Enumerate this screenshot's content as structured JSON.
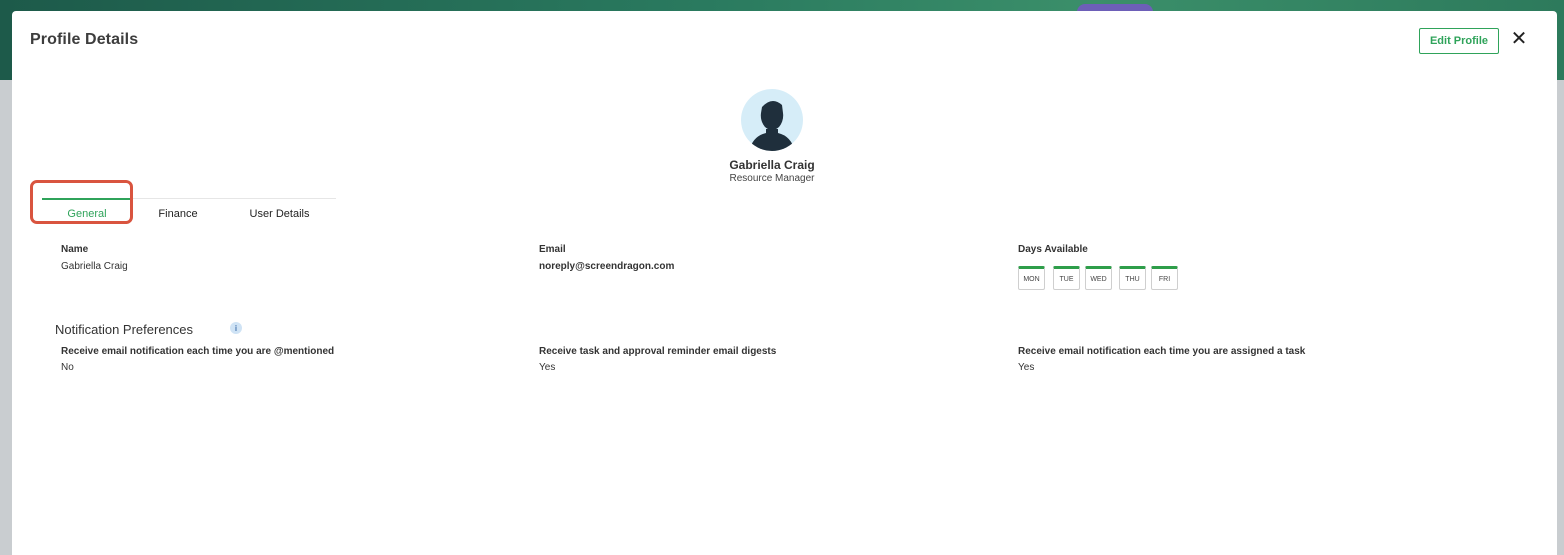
{
  "modal": {
    "title": "Profile Details",
    "edit_label": "Edit Profile",
    "close_glyph": "✕"
  },
  "profile": {
    "name": "Gabriella Craig",
    "role": "Resource Manager",
    "avatar_icon": "user-silhouette-icon"
  },
  "tabs": [
    {
      "label": "General",
      "active": true
    },
    {
      "label": "Finance",
      "active": false
    },
    {
      "label": "User Details",
      "active": false
    }
  ],
  "general": {
    "name": {
      "label": "Name",
      "value": "Gabriella Craig"
    },
    "email": {
      "label": "Email",
      "value": "noreply@screendragon.com"
    },
    "days": {
      "label": "Days Available",
      "items": [
        "MON",
        "TUE",
        "WED",
        "THU",
        "FRI"
      ]
    }
  },
  "notifications": {
    "title": "Notification Preferences",
    "info_glyph": "i",
    "items": [
      {
        "label": "Receive email notification each time you are @mentioned",
        "value": "No"
      },
      {
        "label": "Receive task and approval reminder email digests",
        "value": "Yes"
      },
      {
        "label": "Receive email notification each time you are assigned a task",
        "value": "Yes"
      }
    ]
  },
  "colors": {
    "accent": "#2fa35a",
    "day_active": "#2e9e4a",
    "highlight": "#d9543f"
  }
}
